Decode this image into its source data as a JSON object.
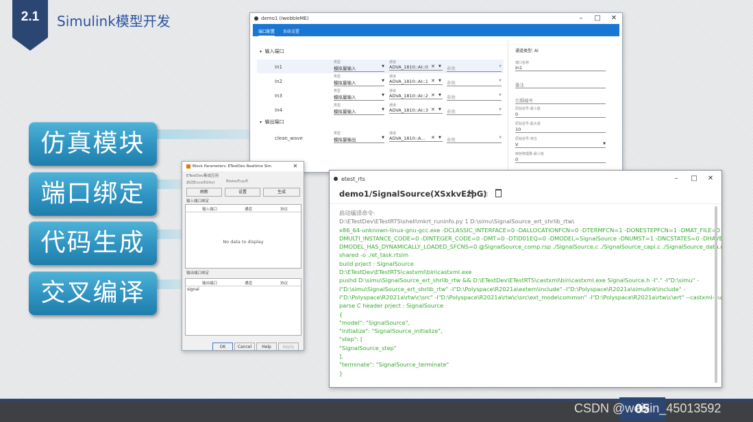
{
  "slide": {
    "section_number": "2.1",
    "section_title": "Simulink模型开发",
    "page_number": "05",
    "watermark": "CSDN @weixin_45013592",
    "side_buttons": [
      "仿真模块",
      "端口绑定",
      "代码生成",
      "交叉编译"
    ]
  },
  "demo1": {
    "title": "demo1 (IwebbleME)",
    "tabs": [
      "端口配置",
      "系统设置"
    ],
    "input_section": "输入端口",
    "output_section": "输出端口",
    "field_type_label": "类型",
    "field_channel_label": "通道",
    "param_placeholder": "参数",
    "inputs": [
      {
        "name": "In1",
        "type": "模拟量输入",
        "channel": "ADVA_1810::AI::0"
      },
      {
        "name": "In2",
        "type": "模拟量输入",
        "channel": "ADVA_1810::AI::1"
      },
      {
        "name": "In3",
        "type": "模拟量输入",
        "channel": "ADVA_1810::AI::2"
      },
      {
        "name": "In4",
        "type": "模拟量输入",
        "channel": "ADVA_1810::AI::3"
      }
    ],
    "outputs": [
      {
        "name": "clean_wave",
        "type": "模拟量输出",
        "channel": "ADVA_1810::A..."
      }
    ],
    "right_panel": {
      "channel_type": "通道类型: AI",
      "port_name_label": "端口名称",
      "port_name_value": "In1",
      "note_label": "备注",
      "pin_label": "引脚编号",
      "min_label": "原始信号-最小值",
      "min_value": "0",
      "max_label": "原始信号-最大值",
      "max_value": "10",
      "unit_label": "原始信号-单位",
      "unit_value": "V",
      "phys_min_label": "映射物理量-最小值",
      "phys_min_value": "0"
    }
  },
  "block": {
    "title": "Block Parameters: ETestDev Realtime Sim",
    "subtitle": "ETestDev集成应用",
    "field1": "启动ExcelEditor",
    "field2": "Blake/Ecp/E",
    "buttons": [
      "刷新",
      "设置",
      "生成"
    ],
    "input_label": "输入端口绑定",
    "output_label": "输出端口绑定",
    "col_headers": [
      "输入端口",
      "通道",
      "协议"
    ],
    "col_headers_out": [
      "输出端口",
      "通道",
      "协议"
    ],
    "empty_text": "No data to display",
    "output_row": "signal",
    "footer_buttons": [
      "OK",
      "Cancel",
      "Help",
      "Apply"
    ]
  },
  "etest": {
    "title": "etest_rts",
    "heading": "demo1/SignalSource(XSxkvEzpG)",
    "log_header": "启动编译命令:",
    "log_lines": [
      "D:\\ETestDev\\ETestRTS\\shell\\mkrt_runinfo.py 1 D:\\simu\\SignalSource_ert_shrlib_rtw\\",
      "x86_64-unknown-linux-gnu-gcc.exe -DCLASSIC_INTERFACE=0 -DALLOCATIONFCN=0 -DTERMFCN=1 -DONESTEPFCN=1 -DMAT_FILE=0 -",
      "DMULTI_INSTANCE_CODE=0 -DINTEGER_CODE=0 -DMT=0 -DTID01EQ=0 -DMODEL=SignalSource -DNUMST=1 -DNCSTATES=0 -DHAVESTDIO -",
      "DMODEL_HAS_DYNAMICALLY_LOADED_SFCNS=0 @SignalSource_comp.rsp ./SignalSource.c ./SignalSource_capi.c ./SignalSource_data.c -fPIC -",
      "shared -o ./et_task.rtsim",
      "build prject : SignalSource",
      "D:\\ETestDev\\ETestRTS\\castxml\\bin\\castxml.exe",
      "pushd D:\\simu\\SignalSource_ert_shrlib_rtw && D:\\ETestDev\\ETestRTS\\castxml\\bin\\castxml.exe SignalSource.h -I\".\" -I\"D:\\simu\" -",
      "I\"D:\\simu\\SignalSource_ert_shrlib_rtw\" -I\"D:\\Polyspace\\R2021a\\extern\\include\" -I\"D:\\Polyspace\\R2021a\\simulink\\include\" -",
      "I\"D:\\Polyspace\\R2021a\\rtw\\c\\src\" -I\"D:\\Polyspace\\R2021a\\rtw\\c\\src\\ext_mode\\common\" -I\"D:\\Polyspace\\R2021a\\rtw\\c\\ert\" --castxml-output=1",
      "parse C header prject : SignalSource",
      "{",
      "\"model\": \"SignalSource\",",
      "\"initialize\": \"SignalSource_initialize\",",
      "\"step\": [",
      "\"SignalSource_step\"",
      "],",
      "\"terminate\": \"SignalSource_terminate\"",
      "}"
    ]
  }
}
